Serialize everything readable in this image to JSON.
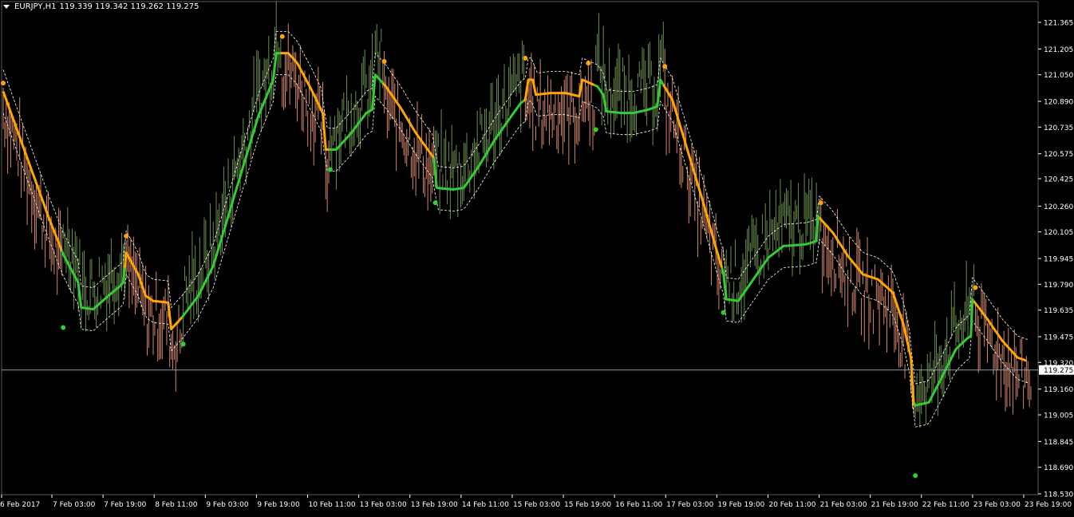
{
  "title": {
    "symbol": "EURJPY,H1",
    "ohlc": "119.339 119.342 119.262 119.275"
  },
  "colors": {
    "background": "#000000",
    "axis_text": "#ffffff",
    "bull_bar": "#6b8e4e",
    "bear_bar": "#d2866a",
    "uptrend": "#32cd32",
    "downtrend": "#ffa500",
    "band": "#ffffff",
    "price_line": "#8ba0b4"
  },
  "chart_data": {
    "type": "line",
    "title": "EURJPY,H1",
    "ylim": [
      118.53,
      121.45
    ],
    "y_ticks": [
      "121.365",
      "121.205",
      "121.050",
      "120.890",
      "120.735",
      "120.575",
      "120.425",
      "120.260",
      "120.105",
      "119.945",
      "119.790",
      "119.635",
      "119.475",
      "119.320",
      "119.160",
      "119.005",
      "118.845",
      "118.690",
      "118.530"
    ],
    "x_ticks": [
      "6 Feb 2017",
      "7 Feb 03:00",
      "7 Feb 19:00",
      "8 Feb 11:00",
      "9 Feb 03:00",
      "9 Feb 19:00",
      "10 Feb 11:00",
      "13 Feb 03:00",
      "13 Feb 19:00",
      "14 Feb 11:00",
      "15 Feb 03:00",
      "15 Feb 19:00",
      "16 Feb 11:00",
      "17 Feb 03:00",
      "19 Feb 19:00",
      "20 Feb 11:00",
      "21 Feb 03:00",
      "21 Feb 19:00",
      "22 Feb 11:00",
      "23 Feb 03:00",
      "23 Feb 19:00"
    ],
    "current_price": "119.275",
    "grid": false,
    "trend_line": [
      [
        0,
        120.95
      ],
      [
        10,
        120.7
      ],
      [
        20,
        120.45
      ],
      [
        30,
        120.2
      ],
      [
        40,
        119.97
      ],
      [
        50,
        119.8
      ],
      [
        52,
        119.65
      ],
      [
        60,
        119.64
      ],
      [
        70,
        119.72
      ],
      [
        78,
        119.78
      ],
      [
        80,
        119.8
      ],
      [
        82,
        119.98
      ],
      [
        90,
        119.85
      ],
      [
        95,
        119.72
      ],
      [
        100,
        119.69
      ],
      [
        110,
        119.68
      ],
      [
        112,
        119.52
      ],
      [
        120,
        119.6
      ],
      [
        130,
        119.72
      ],
      [
        140,
        119.9
      ],
      [
        150,
        120.2
      ],
      [
        160,
        120.5
      ],
      [
        170,
        120.8
      ],
      [
        180,
        121.02
      ],
      [
        182,
        121.18
      ],
      [
        190,
        121.18
      ],
      [
        196,
        121.12
      ],
      [
        206,
        120.95
      ],
      [
        213,
        120.82
      ],
      [
        215,
        120.6
      ],
      [
        222,
        120.6
      ],
      [
        232,
        120.7
      ],
      [
        242,
        120.82
      ],
      [
        246,
        120.84
      ],
      [
        248,
        121.05
      ],
      [
        255,
        120.98
      ],
      [
        265,
        120.85
      ],
      [
        275,
        120.7
      ],
      [
        287,
        120.55
      ],
      [
        289,
        120.37
      ],
      [
        300,
        120.36
      ],
      [
        307,
        120.37
      ],
      [
        317,
        120.5
      ],
      [
        327,
        120.65
      ],
      [
        337,
        120.78
      ],
      [
        345,
        120.88
      ],
      [
        348,
        120.9
      ],
      [
        350,
        121.02
      ],
      [
        353,
        121.02
      ],
      [
        355,
        120.93
      ],
      [
        365,
        120.94
      ],
      [
        375,
        120.94
      ],
      [
        384,
        120.92
      ],
      [
        386,
        121.02
      ],
      [
        396,
        120.98
      ],
      [
        400,
        120.93
      ],
      [
        402,
        120.83
      ],
      [
        412,
        120.82
      ],
      [
        420,
        120.82
      ],
      [
        430,
        120.84
      ],
      [
        436,
        120.86
      ],
      [
        438,
        121.02
      ],
      [
        446,
        120.9
      ],
      [
        456,
        120.6
      ],
      [
        466,
        120.3
      ],
      [
        476,
        119.98
      ],
      [
        480,
        119.86
      ],
      [
        482,
        119.7
      ],
      [
        490,
        119.69
      ],
      [
        500,
        119.82
      ],
      [
        510,
        119.95
      ],
      [
        520,
        120.02
      ],
      [
        535,
        120.03
      ],
      [
        542,
        120.05
      ],
      [
        543,
        120.2
      ],
      [
        553,
        120.1
      ],
      [
        563,
        119.96
      ],
      [
        573,
        119.85
      ],
      [
        583,
        119.82
      ],
      [
        593,
        119.74
      ],
      [
        600,
        119.55
      ],
      [
        605,
        119.35
      ],
      [
        607,
        119.06
      ],
      [
        617,
        119.08
      ],
      [
        625,
        119.22
      ],
      [
        635,
        119.4
      ],
      [
        642,
        119.46
      ],
      [
        645,
        119.48
      ],
      [
        646,
        119.7
      ],
      [
        656,
        119.58
      ],
      [
        666,
        119.45
      ],
      [
        676,
        119.35
      ],
      [
        682,
        119.33
      ]
    ],
    "turning_points_down": [
      [
        0,
        121.0
      ],
      [
        82,
        120.08
      ],
      [
        186,
        121.28
      ],
      [
        254,
        121.13
      ],
      [
        348,
        121.15
      ],
      [
        390,
        121.12
      ],
      [
        441,
        121.1
      ],
      [
        545,
        120.28
      ],
      [
        648,
        119.77
      ]
    ],
    "turning_points_up": [
      [
        40,
        119.53
      ],
      [
        120,
        119.43
      ],
      [
        218,
        120.48
      ],
      [
        288,
        120.28
      ],
      [
        395,
        120.72
      ],
      [
        480,
        119.62
      ],
      [
        608,
        118.64
      ]
    ]
  }
}
